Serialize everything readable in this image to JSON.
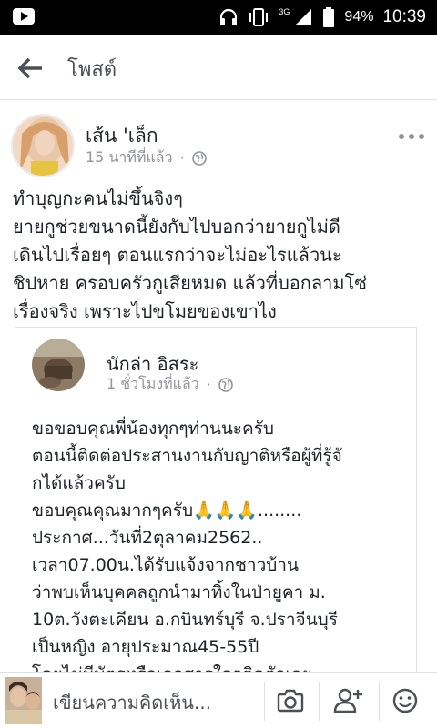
{
  "status_bar": {
    "network": "3G",
    "battery": "94%",
    "time": "10:39"
  },
  "header": {
    "title": "โพสต์"
  },
  "post": {
    "author": "เส้น 'เล็ก",
    "time": "15 นาทีที่แล้ว",
    "separator": "·",
    "lines": [
      "ทำบุญกะคนไม่ขึ้นจิงๆ",
      "ยายกูช่วยขนาดนี้ยังกับไปบอกว่ายายกูไม่ดี",
      "เดินไปเรื่อยๆ ตอนแรกว่าจะไม่อะไรแล้วนะ",
      "ชิปหาย ครอบครัวกูเสียหมด แล้วที่บอกลามโซ่",
      "เรื่องจริง เพราะไปขโมยของเขาไง"
    ]
  },
  "shared_post": {
    "author": "นักล่า อิสระ",
    "time": "1 ชั่วโมงที่แล้ว",
    "separator": "·",
    "lines": [
      "ขอขอบคุณพี่น้องทุกๆท่านนะครับ",
      "ตอนนี้ติดต่อประสานงานกับญาติหรือผู้ที่รู้จั",
      "กได้แล้วครับ",
      "ขอบคุณคุณมากๆครับ🙏🙏🙏........",
      "ประกาศ...วันที่2ตุลาคม2562..",
      "เวลา07.00น.ได้รับแจ้งจากชาวบ้าน",
      "ว่าพบเห็นบุคคลถูกนำมาทิ้งในป่ายูคา ม.",
      "10ต.วังตะเคียน อ.กบินทร์บุรี จ.ปราจีนบุรี",
      "เป็นหญิง อายุประมาณ45-55ปี",
      "โดยไม่มีบัตรหรือเอกสารใดๆติดตัวเลย"
    ]
  },
  "composer": {
    "placeholder": "เขียนความคิดเห็น..."
  },
  "colors": {
    "text": "#1d2129",
    "meta": "#90949c",
    "divider": "#dddfe2"
  },
  "icons": [
    "youtube-icon",
    "headphones-icon",
    "vibrate-icon",
    "signal-icon",
    "battery-icon",
    "back-arrow-icon",
    "globe-icon",
    "more-icon",
    "camera-icon",
    "add-friend-icon",
    "emoji-icon"
  ]
}
